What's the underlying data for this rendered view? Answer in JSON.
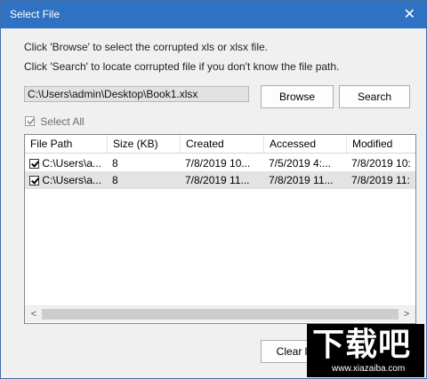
{
  "dialog": {
    "title": "Select File",
    "close_glyph": "✕",
    "instruction_browse": "Click 'Browse' to select the corrupted xls or xlsx file.",
    "instruction_search": "Click 'Search' to locate corrupted file if you don't know the file path."
  },
  "path_field": {
    "value": "C:\\Users\\admin\\Desktop\\Book1.xlsx"
  },
  "buttons": {
    "browse": "Browse",
    "search": "Search",
    "clear": "Clear l"
  },
  "select_all": {
    "label": "Select All",
    "checked": true,
    "enabled": false
  },
  "table": {
    "columns": [
      "File Path",
      "Size (KB)",
      "Created",
      "Accessed",
      "Modified"
    ],
    "rows": [
      {
        "checked": true,
        "path": "C:\\Users\\a...",
        "size": "8",
        "created": "7/8/2019 10...",
        "accessed": "7/5/2019 4:...",
        "modified": "7/8/2019 10:",
        "selected": false
      },
      {
        "checked": true,
        "path": "C:\\Users\\a...",
        "size": "8",
        "created": "7/8/2019 11...",
        "accessed": "7/8/2019 11...",
        "modified": "7/8/2019 11:",
        "selected": true
      }
    ]
  },
  "scrollbar": {
    "left_arrow": "<",
    "right_arrow": ">"
  },
  "watermark": {
    "text": "下载吧",
    "url": "www.xiazaiba.com"
  },
  "colors": {
    "titlebar": "#2f72c4",
    "selected_row": "#e3e3e3",
    "dialog_bg": "#f0f0f0"
  }
}
